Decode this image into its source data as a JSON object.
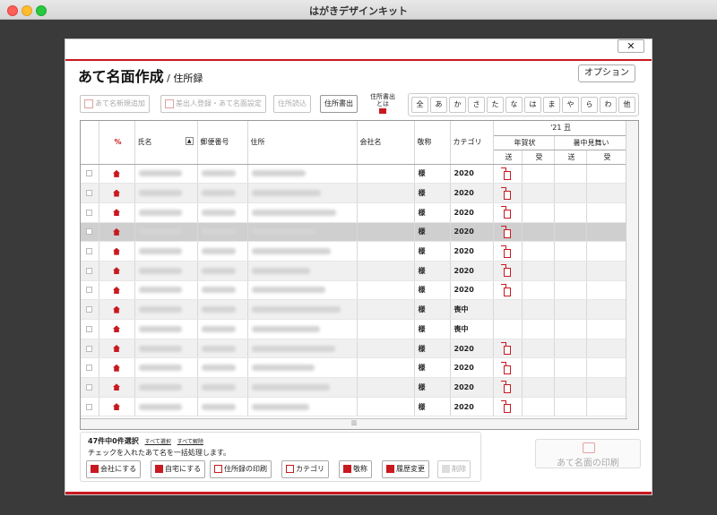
{
  "window": {
    "title": "はがきデザインキット"
  },
  "dialog": {
    "close_label": "✕",
    "title": "あて名面作成",
    "subtitle": " / 住所録",
    "option_label": "オプション"
  },
  "toolbar": {
    "new_label": "あて名新規追加",
    "sender_label": "差出人登録・あて名面設定",
    "import_label": "住所読込",
    "export_label": "住所書出",
    "export_help_label": "住所書出\nとは"
  },
  "kana": [
    "全",
    "あ",
    "か",
    "さ",
    "た",
    "な",
    "は",
    "ま",
    "や",
    "ら",
    "わ",
    "他"
  ],
  "table": {
    "headers": {
      "home_company": "%",
      "name": "氏名",
      "zip": "郵便番号",
      "address": "住所",
      "company": "会社名",
      "honorific": "敬称",
      "category": "カテゴリ",
      "year": "'21 丑",
      "nengajo": "年賀状",
      "shochu": "暑中見舞い",
      "sent": "送",
      "received": "受"
    },
    "rows": [
      {
        "honor": "様",
        "cat": "2020",
        "sent": true,
        "selected": false
      },
      {
        "honor": "様",
        "cat": "2020",
        "sent": true,
        "selected": false
      },
      {
        "honor": "様",
        "cat": "2020",
        "sent": true,
        "selected": false
      },
      {
        "honor": "様",
        "cat": "2020",
        "sent": true,
        "selected": true
      },
      {
        "honor": "様",
        "cat": "2020",
        "sent": true,
        "selected": false
      },
      {
        "honor": "様",
        "cat": "2020",
        "sent": true,
        "selected": false
      },
      {
        "honor": "様",
        "cat": "2020",
        "sent": true,
        "selected": false
      },
      {
        "honor": "様",
        "cat": "喪中",
        "sent": false,
        "selected": false
      },
      {
        "honor": "様",
        "cat": "喪中",
        "sent": false,
        "selected": false
      },
      {
        "honor": "様",
        "cat": "2020",
        "sent": true,
        "selected": false
      },
      {
        "honor": "様",
        "cat": "2020",
        "sent": true,
        "selected": false
      },
      {
        "honor": "様",
        "cat": "2020",
        "sent": true,
        "selected": false
      },
      {
        "honor": "様",
        "cat": "2020",
        "sent": true,
        "selected": false
      }
    ]
  },
  "footer": {
    "count_text": "47件中0件選択",
    "select_all": "すべて選択",
    "deselect_all": "すべて解除",
    "note": "チェックを入れたあて名を一括処理します。",
    "company_label": "会社にする",
    "home_label": "自宅にする",
    "print_list_label": "住所録の印刷",
    "category_label": "カテゴリ",
    "honorific_label": "敬称",
    "history_label": "履歴変更",
    "delete_label": "削除",
    "print_label": "あて名面の印刷"
  },
  "colors": {
    "accent": "#c8191f"
  }
}
